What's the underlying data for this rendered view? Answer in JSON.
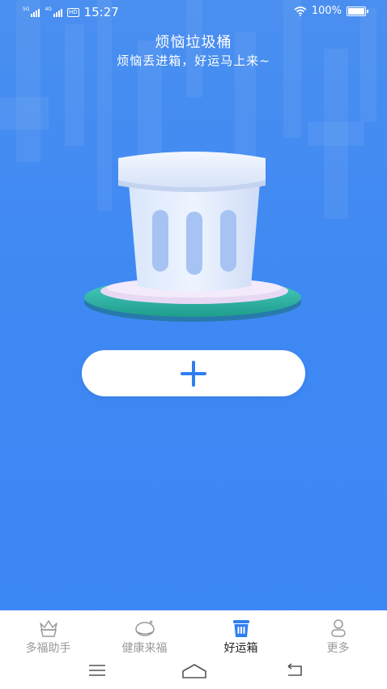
{
  "status_bar": {
    "network1": "5G",
    "network2": "4G",
    "hd": "HD",
    "time": "15:27",
    "battery": "100%"
  },
  "header": {
    "title": "烦恼垃圾桶",
    "subtitle": "烦恼丢进箱，好运马上来~"
  },
  "main": {
    "add_button_icon": "plus-icon"
  },
  "tabs": [
    {
      "label": "多福助手",
      "icon": "crown-basket-icon",
      "active": false
    },
    {
      "label": "健康来福",
      "icon": "health-bag-icon",
      "active": false
    },
    {
      "label": "好运箱",
      "icon": "trash-bin-icon",
      "active": true
    },
    {
      "label": "更多",
      "icon": "person-icon",
      "active": false
    }
  ],
  "system_nav": [
    "menu-icon",
    "home-icon",
    "back-icon"
  ],
  "colors": {
    "accent": "#2f7ef2",
    "background": "#3b86f5"
  }
}
